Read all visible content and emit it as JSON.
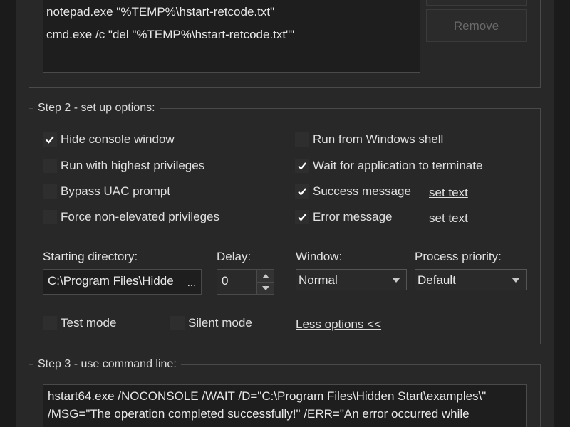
{
  "step1": {
    "commands": [
      "notepad.exe \"%TEMP%\\hstart-retcode.txt\"",
      "cmd.exe /c \"del \"%TEMP%\\hstart-retcode.txt\"\""
    ],
    "remove_label": "Remove"
  },
  "step2": {
    "title": "Step 2 - set up options:",
    "options": {
      "hide_console": {
        "label": "Hide console window",
        "checked": true
      },
      "highest_privileges": {
        "label": "Run with highest privileges",
        "checked": false
      },
      "bypass_uac": {
        "label": "Bypass UAC prompt",
        "checked": false
      },
      "non_elevated": {
        "label": "Force non-elevated privileges",
        "checked": false
      },
      "windows_shell": {
        "label": "Run from Windows shell",
        "checked": false
      },
      "wait_terminate": {
        "label": "Wait for application to terminate",
        "checked": true
      },
      "success_message": {
        "label": "Success message",
        "checked": true
      },
      "error_message": {
        "label": "Error message",
        "checked": true
      },
      "test_mode": {
        "label": "Test mode",
        "checked": false
      },
      "silent_mode": {
        "label": "Silent mode",
        "checked": false
      }
    },
    "set_text_label": "set text",
    "starting_dir_label": "Starting directory:",
    "starting_dir_value": "C:\\Program Files\\Hidde",
    "browse_label": "...",
    "delay_label": "Delay:",
    "delay_value": "0",
    "window_label": "Window:",
    "window_value": "Normal",
    "priority_label": "Process priority:",
    "priority_value": "Default",
    "less_options_label": "Less options <<"
  },
  "step3": {
    "title": "Step 3 - use command line:",
    "lines": [
      "hstart64.exe /NOCONSOLE /WAIT /D=\"C:\\Program Files\\Hidden Start\\examples\\\"",
      "/MSG=\"The operation completed successfully!\" /ERR=\"An error occurred while"
    ]
  }
}
